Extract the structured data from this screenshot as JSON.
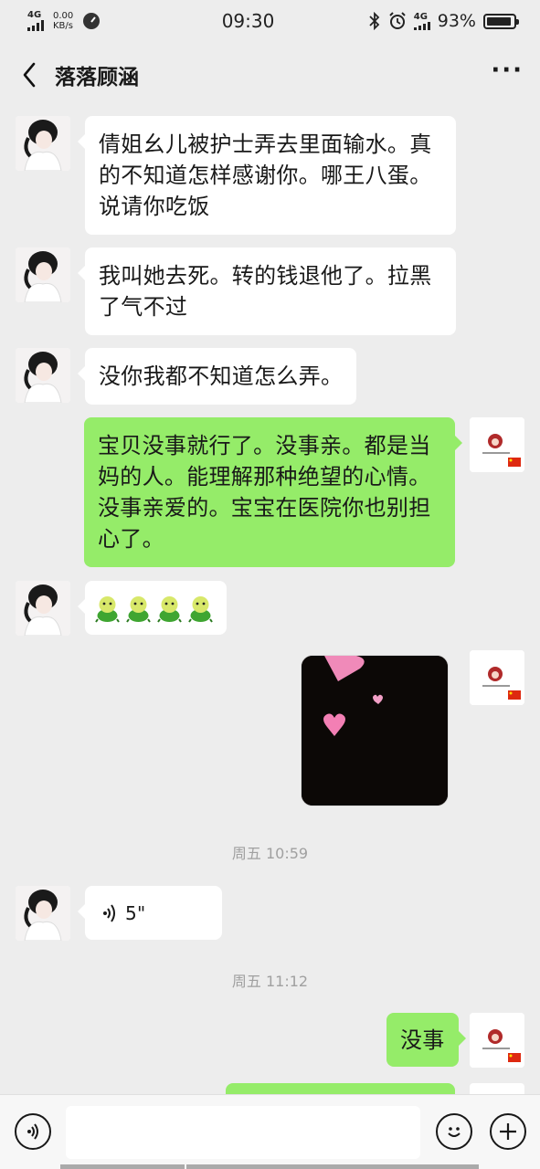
{
  "status_bar": {
    "network": "4G",
    "net_speed_value": "0.00",
    "net_speed_unit": "KB/s",
    "time": "09:30",
    "network_right": "4G",
    "battery": "93%",
    "battery_level": 0.93
  },
  "header": {
    "title": "落落顾涵"
  },
  "messages": [
    {
      "side": "left",
      "text": "倩姐幺儿被护士弄去里面输水。真的不知道怎样感谢你。哪王八蛋。说请你吃饭"
    },
    {
      "side": "left",
      "text": "我叫她去死。转的钱退他了。拉黑了气不过"
    },
    {
      "side": "left",
      "text": "没你我都不知道怎么弄。"
    },
    {
      "side": "right",
      "text": "宝贝没事就行了。没事亲。都是当妈的人。能理解那种绝望的心情。没事亲爱的。宝宝在医院你也别担心了。"
    },
    {
      "side": "left",
      "emoji_count": 4
    },
    {
      "side": "right",
      "type": "image"
    },
    {
      "type": "timestamp",
      "text": "周五 10:59"
    },
    {
      "side": "left",
      "type": "voice",
      "duration": "5\""
    },
    {
      "type": "timestamp",
      "text": "周五 11:12"
    },
    {
      "side": "right",
      "text": "没事"
    }
  ],
  "colors": {
    "background": "#ededed",
    "sent_bubble": "#95ec69",
    "received_bubble": "#ffffff"
  }
}
